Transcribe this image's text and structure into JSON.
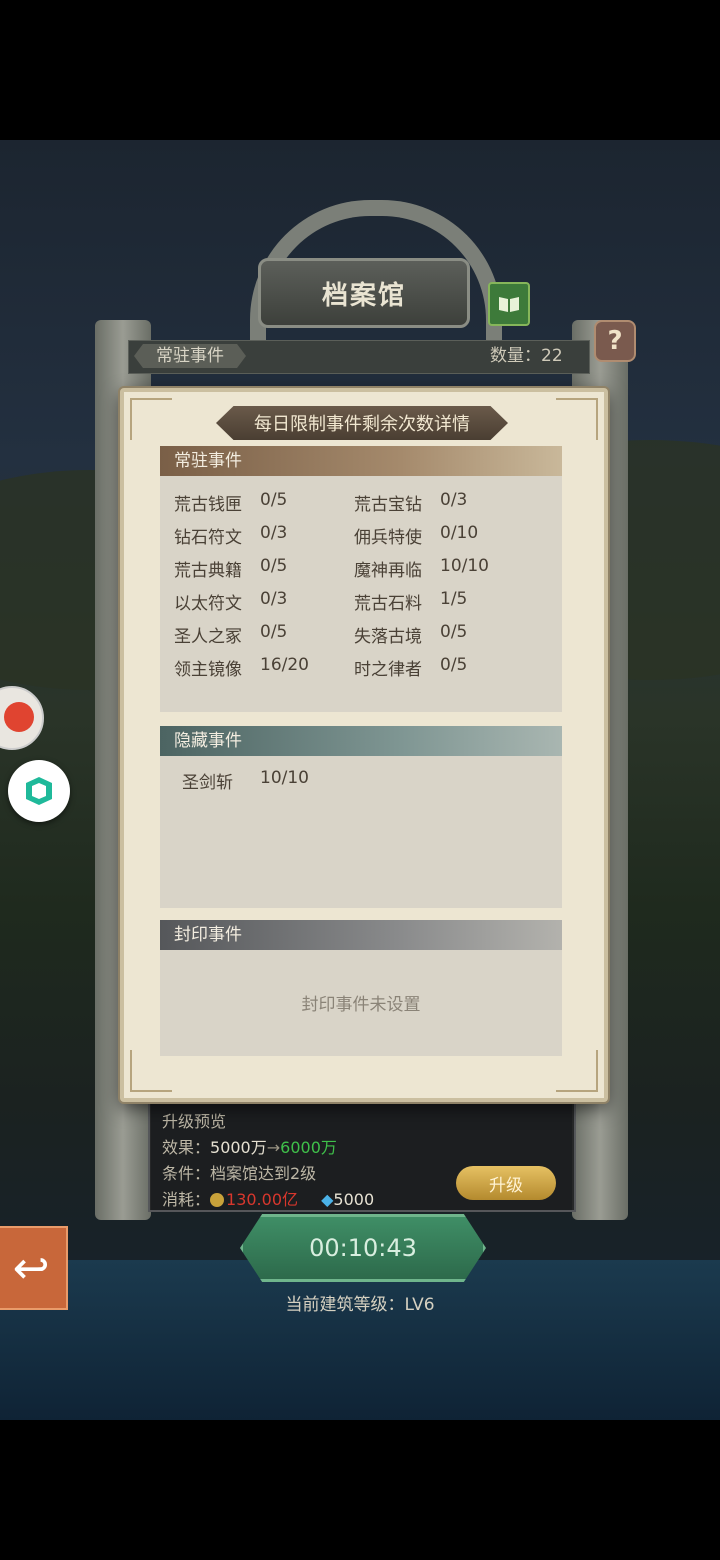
{
  "building": {
    "title": "档案馆",
    "tab_label": "常驻事件",
    "count_label": "数量：22",
    "help_icon": "?"
  },
  "popup": {
    "title": "每日限制事件剩余次数详情",
    "resident": {
      "header": "常驻事件",
      "items": [
        {
          "name": "荒古钱匣",
          "value": "0/5"
        },
        {
          "name": "荒古宝钻",
          "value": "0/3"
        },
        {
          "name": "钻石符文",
          "value": "0/3"
        },
        {
          "name": "佣兵特使",
          "value": "0/10"
        },
        {
          "name": "荒古典籍",
          "value": "0/5"
        },
        {
          "name": "魔神再临",
          "value": "10/10"
        },
        {
          "name": "以太符文",
          "value": "0/3"
        },
        {
          "name": "荒古石料",
          "value": "1/5"
        },
        {
          "name": "圣人之冢",
          "value": "0/5"
        },
        {
          "name": "失落古境",
          "value": "0/5"
        },
        {
          "name": "领主镜像",
          "value": "16/20"
        },
        {
          "name": "时之律者",
          "value": "0/5"
        }
      ]
    },
    "hidden": {
      "header": "隐藏事件",
      "items": [
        {
          "name": "圣剑斩",
          "value": "10/10"
        }
      ]
    },
    "sealed": {
      "header": "封印事件",
      "empty_text": "封印事件未设置"
    }
  },
  "upgrade": {
    "header": "升级预览",
    "effect_label": "效果：",
    "effect_from": "5000万",
    "arrow": "→",
    "effect_to": "6000万",
    "condition": "条件：档案馆达到2级",
    "cost_label": "消耗：",
    "cost_gold": "130.00亿",
    "cost_diamond": "5000",
    "button_label": "升级"
  },
  "timer": "00:10:43",
  "current_level": "当前建筑等级：LV6",
  "colors": {
    "effect_to": "#3fc04a",
    "cost_gold": "#d8372d",
    "timer_green": "#3f8e66",
    "upgrade_gold": "#d6ae4a"
  },
  "icons": [
    "book-icon",
    "help-icon",
    "gold-coin-icon",
    "diamond-icon",
    "back-arrow-icon",
    "cube-icon"
  ]
}
